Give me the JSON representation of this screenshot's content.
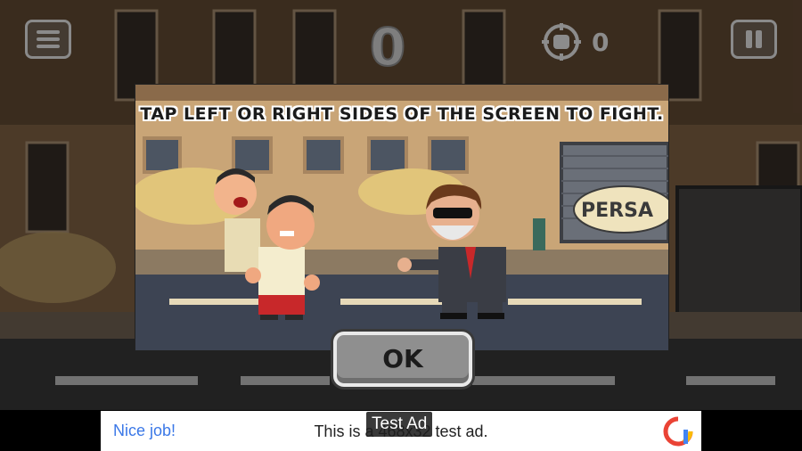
{
  "hud": {
    "score": "0",
    "knockouts": "0",
    "menu_icon": "hamburger-menu-icon",
    "pause_icon": "pause-icon",
    "fist_icon": "fist-target-icon"
  },
  "tutorial": {
    "instruction": "TAP LEFT OR RIGHT SIDES OF THE SCREEN TO FIGHT.",
    "ok_label": "OK",
    "graffiti_text": "PERSA"
  },
  "ad": {
    "tag": "Test Ad",
    "headline": "Nice job!",
    "body": "This is a 468x32 test ad.",
    "logo_icon": "admob-logo-icon"
  },
  "colors": {
    "ad_headline": "#3b78e7",
    "button_gray": "#8f8f8f",
    "street_asphalt": "#3d4453",
    "building_tan": "#c49a6a"
  }
}
